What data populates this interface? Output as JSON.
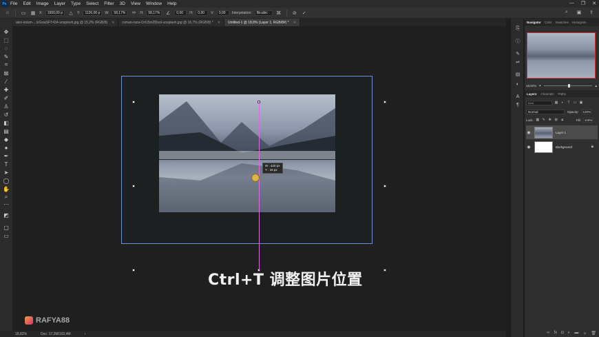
{
  "menubar": {
    "app_logo": "Ps",
    "items": [
      "File",
      "Edit",
      "Image",
      "Layer",
      "Type",
      "Select",
      "Filter",
      "3D",
      "View",
      "Window",
      "Help"
    ],
    "window_controls": [
      "—",
      "❐",
      "✕"
    ]
  },
  "options": {
    "x_label": "X:",
    "x_value": "1500,00 p",
    "y_label": "Y:",
    "y_value": "1126,00 p",
    "w_label": "W:",
    "w_value": "58,17%",
    "h_label": "H:",
    "h_value": "58,17%",
    "angle_value": "0,00",
    "hskew_label": "H:",
    "hskew_value": "0,00",
    "vskew_label": "V:",
    "vskew_value": "0,00",
    "interp_label": "Interpolation:",
    "interp_value": "Bicubic"
  },
  "tabs": [
    {
      "title": "alex-knism-...ivGsiaSFY434-unsplash.jpg @ 15,2% (RGB/8)",
      "active": false
    },
    {
      "title": "roman-rana-Ort15m2f2sol-unsplash.jpg @ 16,7% (RGB/8) *",
      "active": false
    },
    {
      "title": "Untitled-1 @ 18,8% (Layer 1, RGB/8#) *",
      "active": true
    }
  ],
  "canvas": {
    "readout_w": "W : 420 px",
    "readout_h": "Y : 16 px"
  },
  "overlay": {
    "subtitle": "Ctrl+T 调整图片位置",
    "watermark": "RAFYA88"
  },
  "status": {
    "zoom": "18,82%",
    "doc": "Doc: 17,2M/102,4M"
  },
  "panels": {
    "nav_tabs": [
      "Navigator",
      "Color",
      "Swatches",
      "Histogram"
    ],
    "nav_zoom": "18,82%",
    "layer_tabs": [
      "Layers",
      "Channels",
      "Paths"
    ],
    "kind_placeholder": "Kind",
    "blend_mode": "Normal",
    "opacity_label": "Opacity:",
    "opacity_value": "100%",
    "lock_label": "Lock:",
    "fill_label": "Fill:",
    "fill_value": "100%",
    "layers": [
      {
        "name": "Layer 1",
        "selected": true
      },
      {
        "name": "Background",
        "selected": false,
        "locked": true
      }
    ]
  },
  "colors": {
    "selection_frame": "#6f8fd8",
    "guide": "#d66be3",
    "nav_viewport": "#cc3333"
  }
}
